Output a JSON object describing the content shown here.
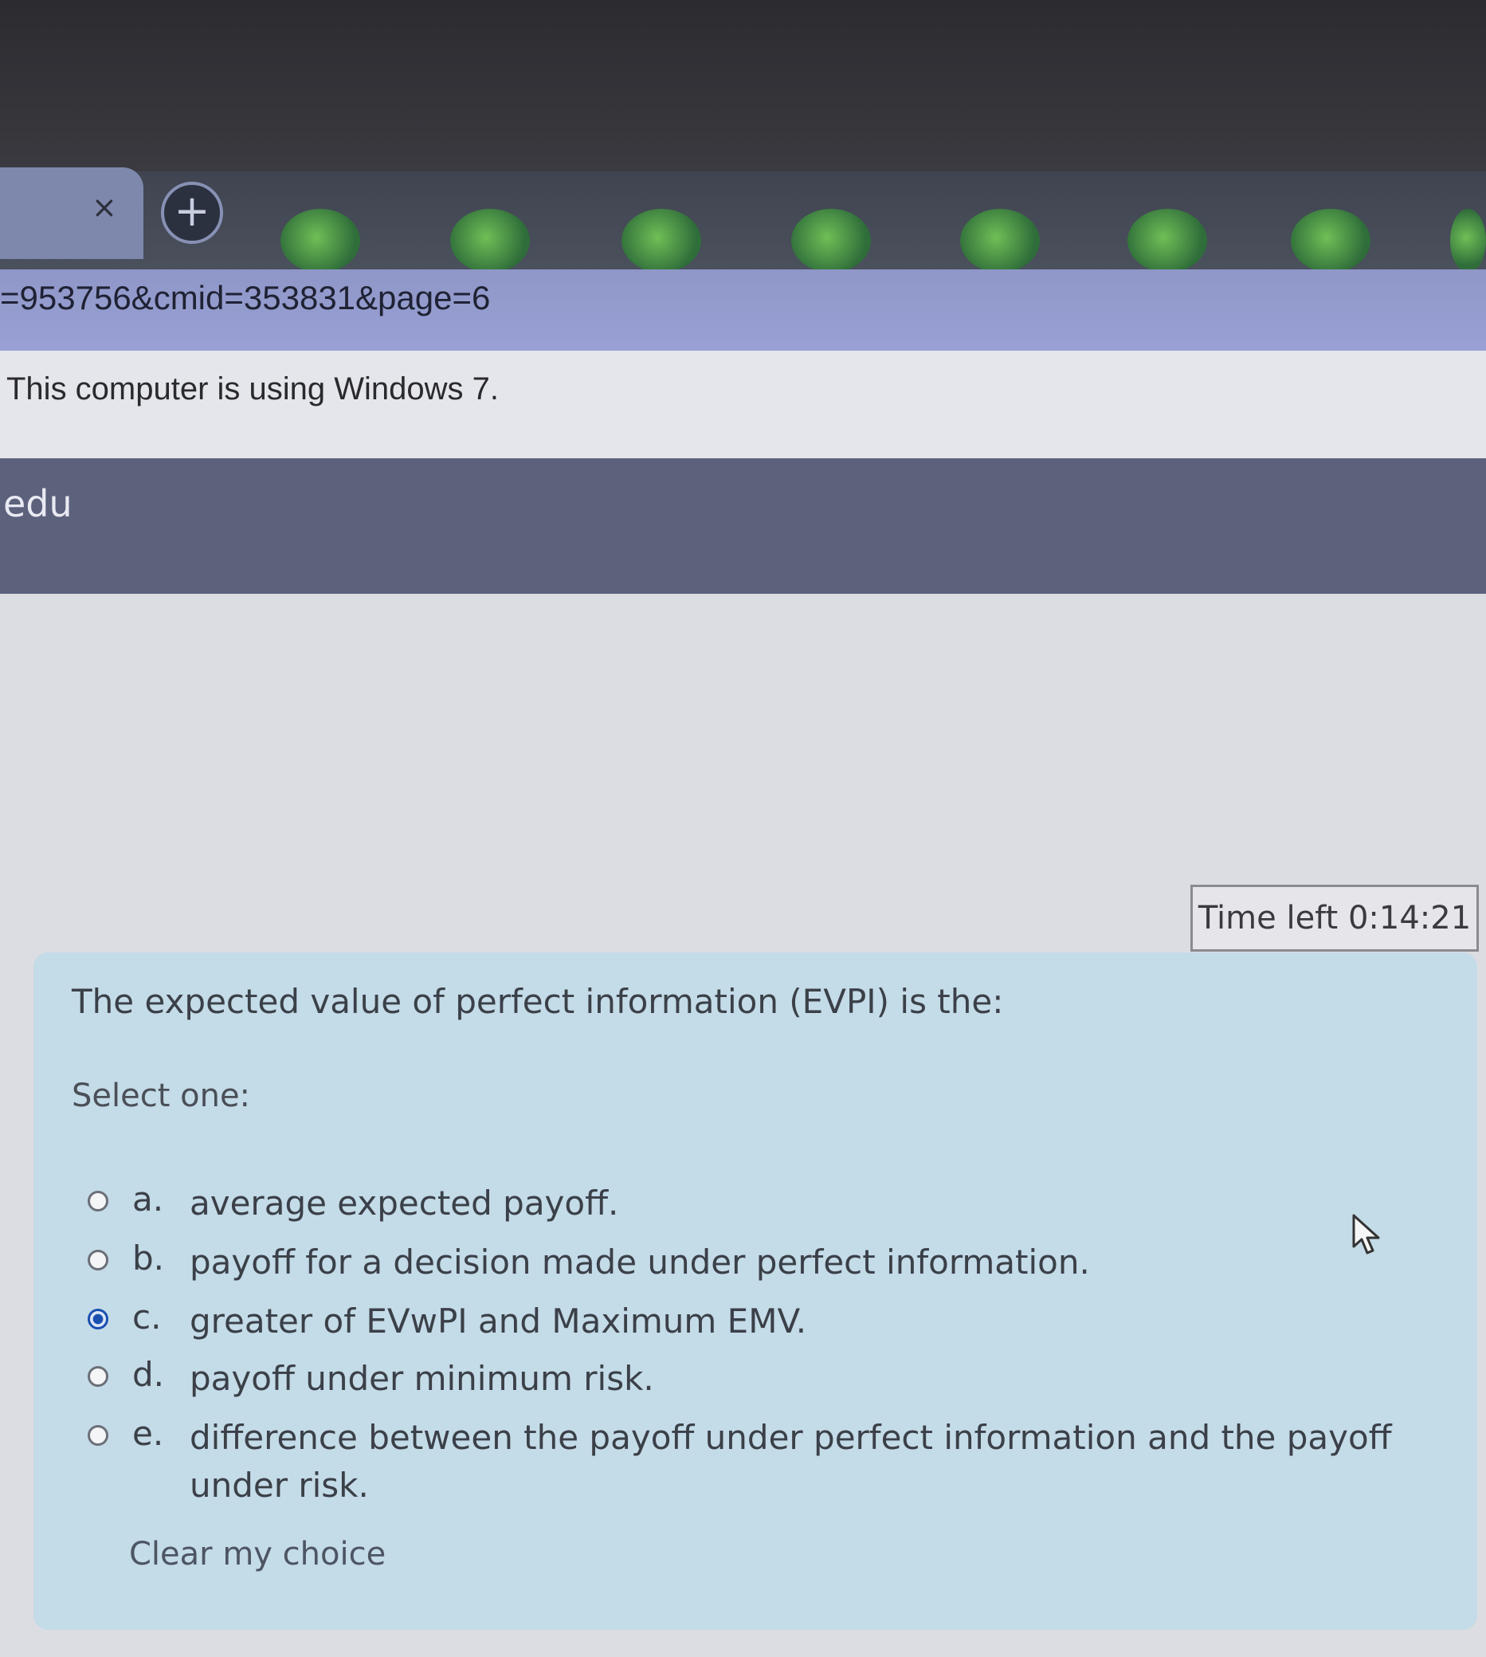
{
  "browser": {
    "tab_close_glyph": "×",
    "new_tab_glyph": "+",
    "url": "=953756&cmid=353831&page=6",
    "info_message": "This computer is using Windows 7."
  },
  "site": {
    "header_text": "edu"
  },
  "quiz": {
    "timer": "Time left 0:14:21",
    "question": "The expected value of perfect information (EVPI) is the:",
    "prompt": "Select one:",
    "options": [
      {
        "letter": "a.",
        "text": "average expected payoff.",
        "selected": false
      },
      {
        "letter": "b.",
        "text": "payoff for a decision made under perfect information.",
        "selected": false
      },
      {
        "letter": "c.",
        "text": "greater of EVwPI and Maximum EMV.",
        "selected": true
      },
      {
        "letter": "d.",
        "text": "payoff under minimum risk.",
        "selected": false
      },
      {
        "letter": "e.",
        "text": "difference between the payoff under perfect information and the payoff under risk.",
        "selected": false
      }
    ],
    "clear_label": "Clear my choice"
  },
  "colors": {
    "card_bg": "#c4dbe8",
    "radio_selected": "#1a4fb0",
    "site_header_bg": "#5c617c"
  }
}
